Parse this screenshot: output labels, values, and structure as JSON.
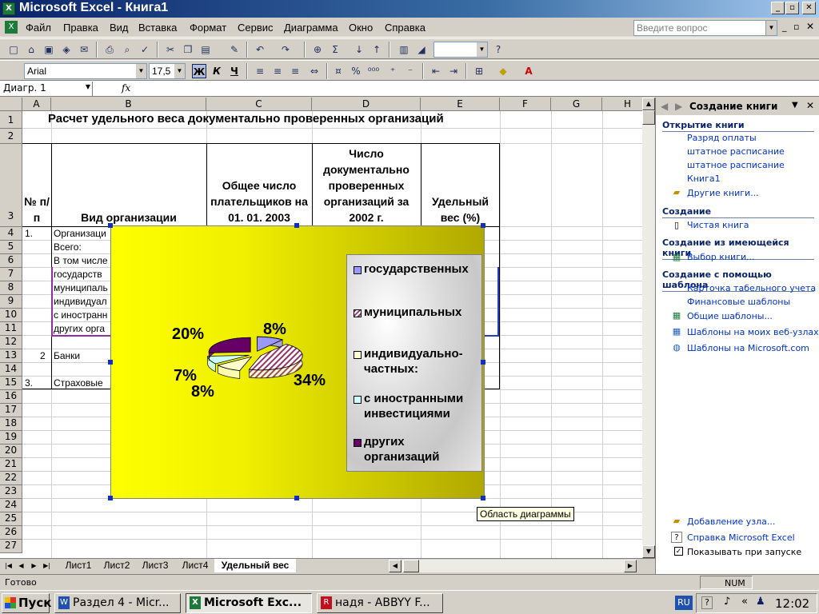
{
  "window": {
    "title": "Microsoft Excel - Книга1"
  },
  "menu": [
    "Файл",
    "Правка",
    "Вид",
    "Вставка",
    "Формат",
    "Сервис",
    "Диаграмма",
    "Окно",
    "Справка"
  ],
  "ask_placeholder": "Введите вопрос",
  "format_toolbar": {
    "font": "Arial",
    "size": "17,5",
    "bold": "Ж",
    "italic": "К",
    "underline": "Ч"
  },
  "formula_bar": {
    "name_box": "Диагр. 1",
    "fx": "fx"
  },
  "columns": [
    "A",
    "B",
    "C",
    "D",
    "E",
    "F",
    "G",
    "H"
  ],
  "rows": [
    "1",
    "2",
    "3",
    "4",
    "5",
    "6",
    "7",
    "8",
    "9",
    "10",
    "11",
    "12",
    "13",
    "14",
    "15",
    "16",
    "17",
    "18",
    "19",
    "20",
    "21",
    "22",
    "23",
    "24",
    "25",
    "26",
    "27"
  ],
  "sheet": {
    "title": "Расчет удельного веса документально проверенных организаций",
    "headers": {
      "a": "№ п/п",
      "b": "Вид организации",
      "c": "Общее число плательщиков на 01. 01. 2003",
      "d": "Число документально проверенных организаций за 2002 г.",
      "e": "Удельный вес (%)"
    },
    "cells": {
      "a4": "1.",
      "b4": "Организаци",
      "b5": "Всего:",
      "b6": "В том числе",
      "b7": "государств",
      "b8": "муниципаль",
      "b9": "индивидуал",
      "b10": "с иностранн",
      "b11": "других орга",
      "a13": "2",
      "b13": "Банки",
      "a15": "3.",
      "b15": "Страховые"
    }
  },
  "chart_data": {
    "type": "pie",
    "style": "3d-exploded",
    "categories": [
      "государственных",
      "муниципальных",
      "индивидуально-частных:",
      "с иностранными инвестициями",
      "других организаций"
    ],
    "values": [
      8,
      34,
      8,
      7,
      20
    ],
    "value_labels": [
      "8%",
      "34%",
      "8%",
      "7%",
      "20%"
    ],
    "legend_position": "right",
    "colors": {
      "state": "#9999ff",
      "municipal": "#993366",
      "private": "#ffffcc",
      "foreign": "#ccffff",
      "other": "#660066"
    },
    "background": "yellow-gradient"
  },
  "tooltip": "Область диаграммы",
  "sheet_tabs": [
    "Лист1",
    "Лист2",
    "Лист3",
    "Лист4",
    "Удельный вес"
  ],
  "active_tab": "Удельный вес",
  "status": {
    "left": "Готово",
    "num": "NUM"
  },
  "task_pane": {
    "title": "Создание книги",
    "open_section": "Открытие книги",
    "open_links": [
      "Разряд оплаты",
      "штатное расписание",
      "штатное расписание",
      "Книга1",
      "Другие книги..."
    ],
    "create_section": "Создание",
    "create_links": [
      "Чистая книга"
    ],
    "existing_section": "Создание из имеющейся книги",
    "existing_links": [
      "Выбор книги..."
    ],
    "template_section": "Создание с помощью шаблона",
    "template_links": [
      "Карточка табельного учета",
      "Финансовые шаблоны",
      "Общие шаблоны...",
      "Шаблоны на моих веб-узлах...",
      "Шаблоны на Microsoft.com"
    ],
    "footer_links": [
      "Добавление узла...",
      "Справка Microsoft Excel"
    ],
    "show_on_start": "Показывать при запуске"
  },
  "taskbar": {
    "start": "Пуск",
    "tasks": [
      "Раздел 4 - Micr...",
      "Microsoft Exc...",
      "надя - ABBYY F..."
    ],
    "lang": "RU",
    "clock": "12:02"
  }
}
